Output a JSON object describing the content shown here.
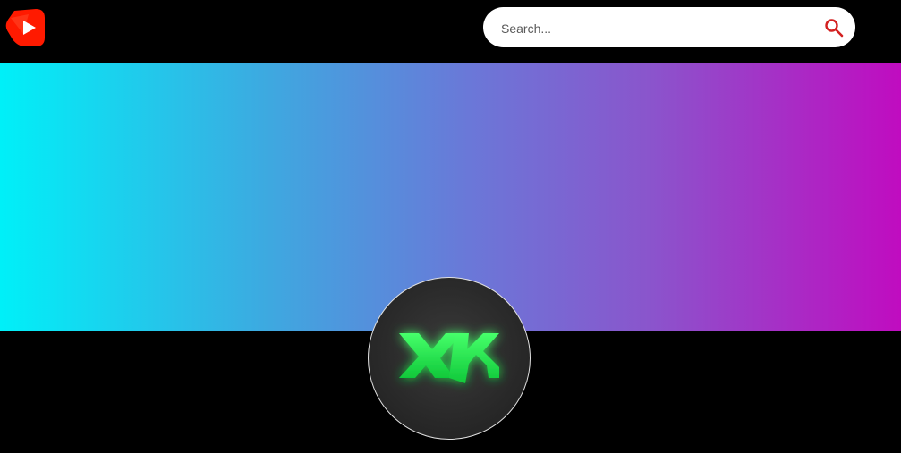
{
  "header": {
    "logo_icon": "play-logo-icon",
    "brand_color": "#ff1a00"
  },
  "search": {
    "placeholder": "Search...",
    "value": "",
    "icon": "search-icon",
    "icon_color": "#d32020"
  },
  "banner": {
    "gradient_colors": [
      "#00f0f8",
      "#3ea8e0",
      "#6a78d8",
      "#8a55cc",
      "#c00cc0"
    ]
  },
  "channel": {
    "avatar_logo": "XK",
    "logo_color": "#1ee64a"
  }
}
